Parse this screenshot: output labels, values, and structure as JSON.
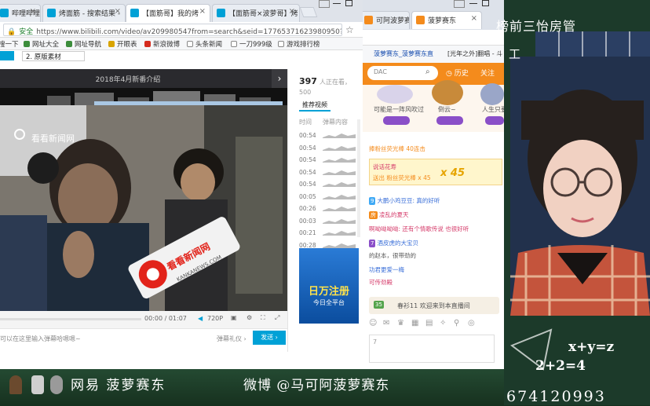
{
  "browser": {
    "tabs": [
      {
        "label": "哔哩哔哩"
      },
      {
        "label": "烤面筋 - 搜索结果 - "
      },
      {
        "label": "【面筋哥】我的烤"
      },
      {
        "label": "【面筋哥×波萝哥】烤"
      }
    ],
    "address": {
      "secure_label": "安全",
      "url": "https://www.bilibili.com/video/av209980547from=search&seid=17765371623980950?0"
    },
    "bookmarks": [
      "搜一下",
      "网址大全",
      "网址导航",
      "开眼表",
      "新浪微博",
      "头条新闻",
      "一刀999级",
      "游戏排行榜"
    ],
    "sub_item": "2.  原版素材"
  },
  "video": {
    "title": "2018年4月新番介绍",
    "next_icon": "›",
    "watermark": "看看新闻网",
    "mic_brand": "看看新闻网",
    "mic_sub": "KANKANEWS.COM",
    "time": "00:00 / 01:07",
    "quality": "720P",
    "danmu_placeholder": "可以在这里输入弹幕哈嗯嗯~",
    "danmu_etiquette": "弹幕礼仪 ›",
    "send_label": "发送 ›"
  },
  "side": {
    "views": "397",
    "views_suffix": "人正在看，500",
    "rec_tab": "推荐视频",
    "col_time": "时间",
    "col_content": "弹幕内容",
    "danmu_times": [
      "00:54",
      "00:54",
      "00:54",
      "00:54",
      "00:54",
      "00:05",
      "00:26",
      "00:03",
      "00:21",
      "00:28"
    ],
    "ad_title": "日万注册",
    "ad_sub": "今日全平台"
  },
  "douyu": {
    "tab1": "可阿波萝赛",
    "tab2": "菠萝赛东",
    "row2a": "菠萝赛东_菠萝赛东直",
    "row2b": "[光年之外]翻唱 - 斗",
    "search_placeholder": "DAC",
    "history": "历史",
    "follow": "关注",
    "sup_left": "可能是一阵风吹过",
    "sup_mid": "倒云~",
    "sup_right": "人生只要",
    "chat_lines": [
      "捧粉丝荧光棒   40连击",
      "说话花寿",
      "送出   粉丝荧光棒 x 45",
      "大鹏小鸡豆豆: 真的好听",
      "凌乱的夏天",
      "啊呦呦呦呦: 还有个情歌传说 也很好听",
      "酒皮虎的大宝贝",
      "的赵本，很带劲的",
      "功君更爱一梅",
      "可传劲殿"
    ],
    "level_badges": [
      "9",
      "7",
      "35"
    ],
    "combo": "x 45",
    "welcome": "春衫11 欢迎来到本直播间",
    "input_placeholder": "7"
  },
  "board": {
    "title": "榜前三怡房管",
    "sub": "工",
    "eq1": "x+y=z",
    "eq2": "2+2=4",
    "group": "群 674120993"
  },
  "footer": {
    "left": "网易 菠萝赛东",
    "right": "微博 @马可阿菠萝赛东"
  },
  "colors": {
    "bilibili_blue": "#00a1d6",
    "douyu_orange": "#f48b1c",
    "chalkboard": "#1c3a2a",
    "plaid": "#c4543c"
  }
}
